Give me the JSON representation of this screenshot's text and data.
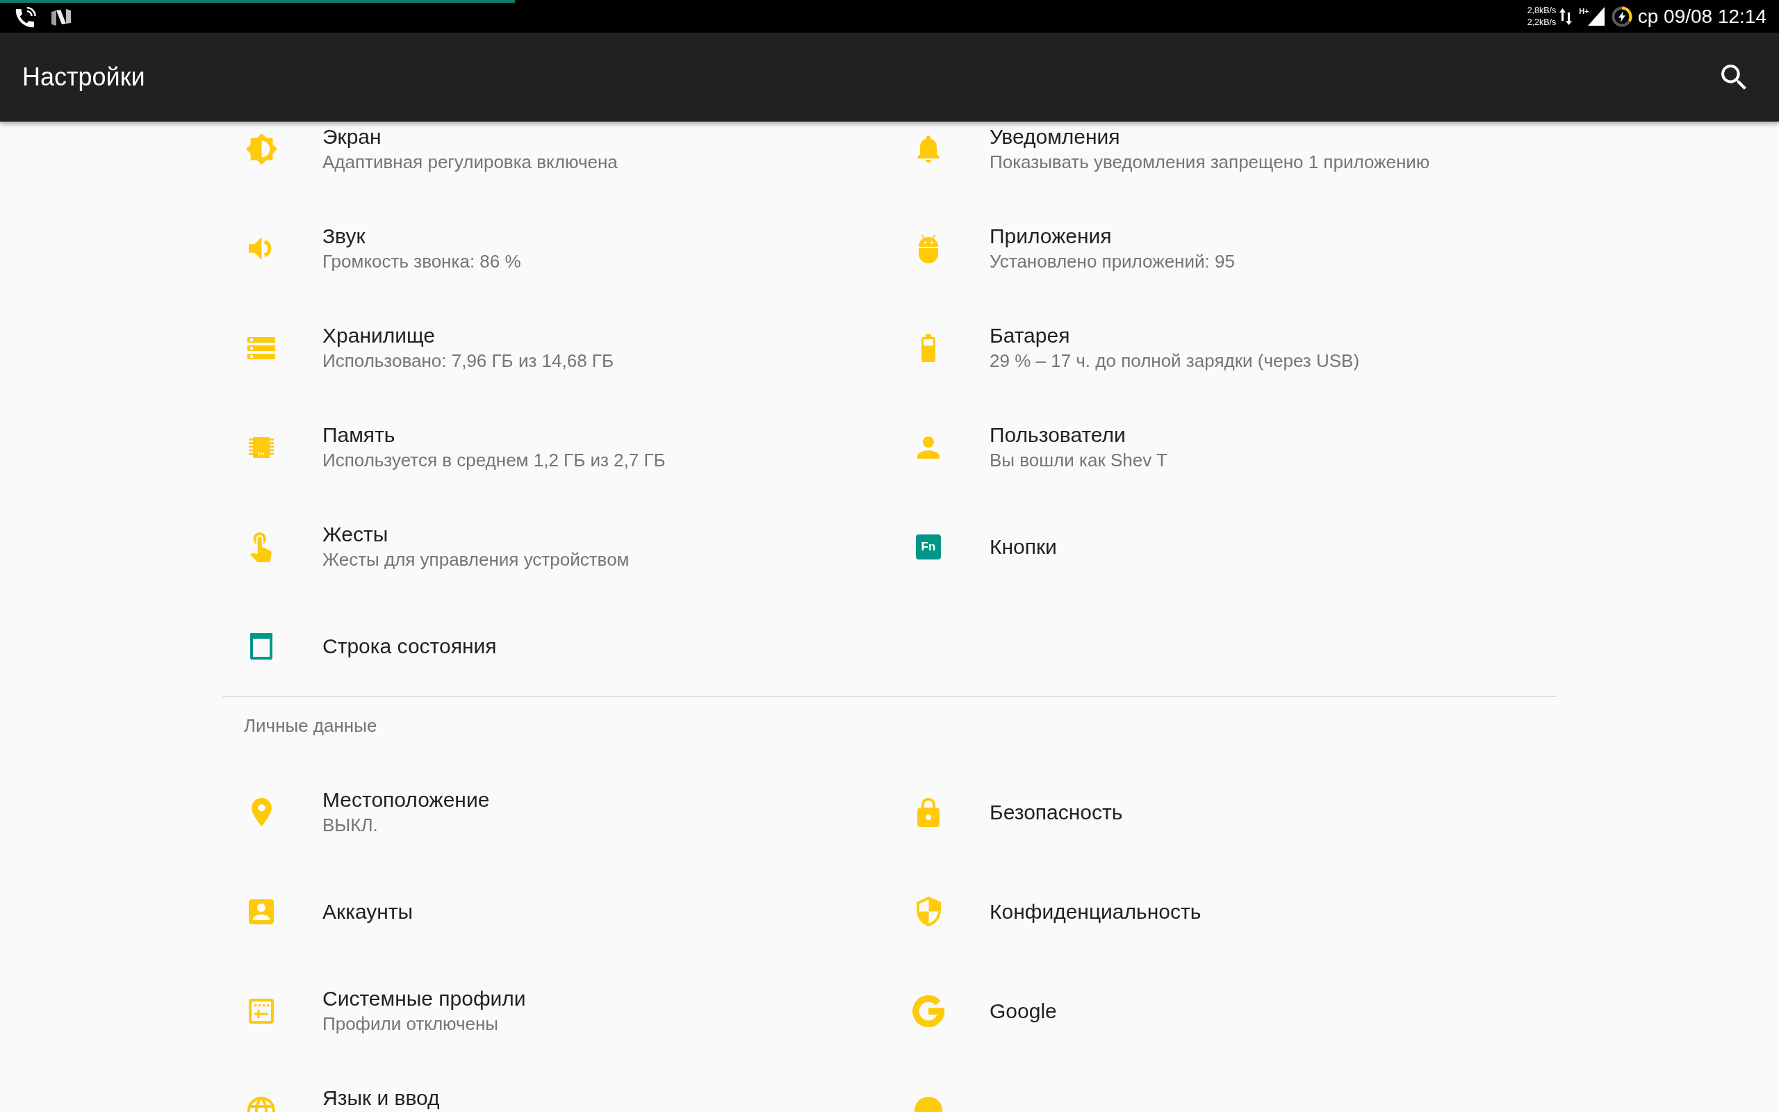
{
  "status_bar": {
    "network_speed": [
      "2,8kB/s",
      "2,2kB/s"
    ],
    "network_type": "H+",
    "clock": "ср 09/08 12:14"
  },
  "app_bar": {
    "title": "Настройки"
  },
  "sections": [
    {
      "items": [
        {
          "kind": "two_line",
          "title": "Экран",
          "subtitle": "Адаптивная регулировка включена"
        },
        {
          "kind": "two_line",
          "title": "Уведомления",
          "subtitle": "Показывать уведомления запрещено 1 приложению"
        },
        {
          "kind": "two_line",
          "title": "Звук",
          "subtitle": "Громкость звонка: 86 %"
        },
        {
          "kind": "two_line",
          "title": "Приложения",
          "subtitle": "Установлено приложений: 95"
        },
        {
          "kind": "two_line",
          "title": "Хранилище",
          "subtitle": "Использовано: 7,96 ГБ из 14,68 ГБ"
        },
        {
          "kind": "two_line",
          "title": "Батарея",
          "subtitle": "29 % – 17 ч. до полной зарядки (через USB)"
        },
        {
          "kind": "two_line",
          "title": "Память",
          "subtitle": "Используется в среднем 1,2 ГБ из 2,7 ГБ"
        },
        {
          "kind": "two_line",
          "title": "Пользователи",
          "subtitle": "Вы вошли как Shev T"
        },
        {
          "kind": "two_line",
          "title": "Жесты",
          "subtitle": "Жесты для управления устройством"
        },
        {
          "kind": "one_line",
          "title": "Кнопки",
          "icon_label": "Fn"
        },
        {
          "kind": "one_line",
          "title": "Строка состояния"
        }
      ]
    },
    {
      "title": "Личные данные",
      "items": [
        {
          "kind": "two_line",
          "title": "Местоположение",
          "subtitle": "ВЫКЛ."
        },
        {
          "kind": "one_line",
          "title": "Безопасность"
        },
        {
          "kind": "one_line",
          "title": "Аккаунты"
        },
        {
          "kind": "one_line",
          "title": "Конфиденциальность"
        },
        {
          "kind": "two_line",
          "title": "Системные профили",
          "subtitle": "Профили отключены"
        },
        {
          "kind": "one_line",
          "title": "Google"
        },
        {
          "kind": "two_line",
          "title": "Язык и ввод"
        },
        {
          "kind": "two_line"
        }
      ]
    }
  ]
}
